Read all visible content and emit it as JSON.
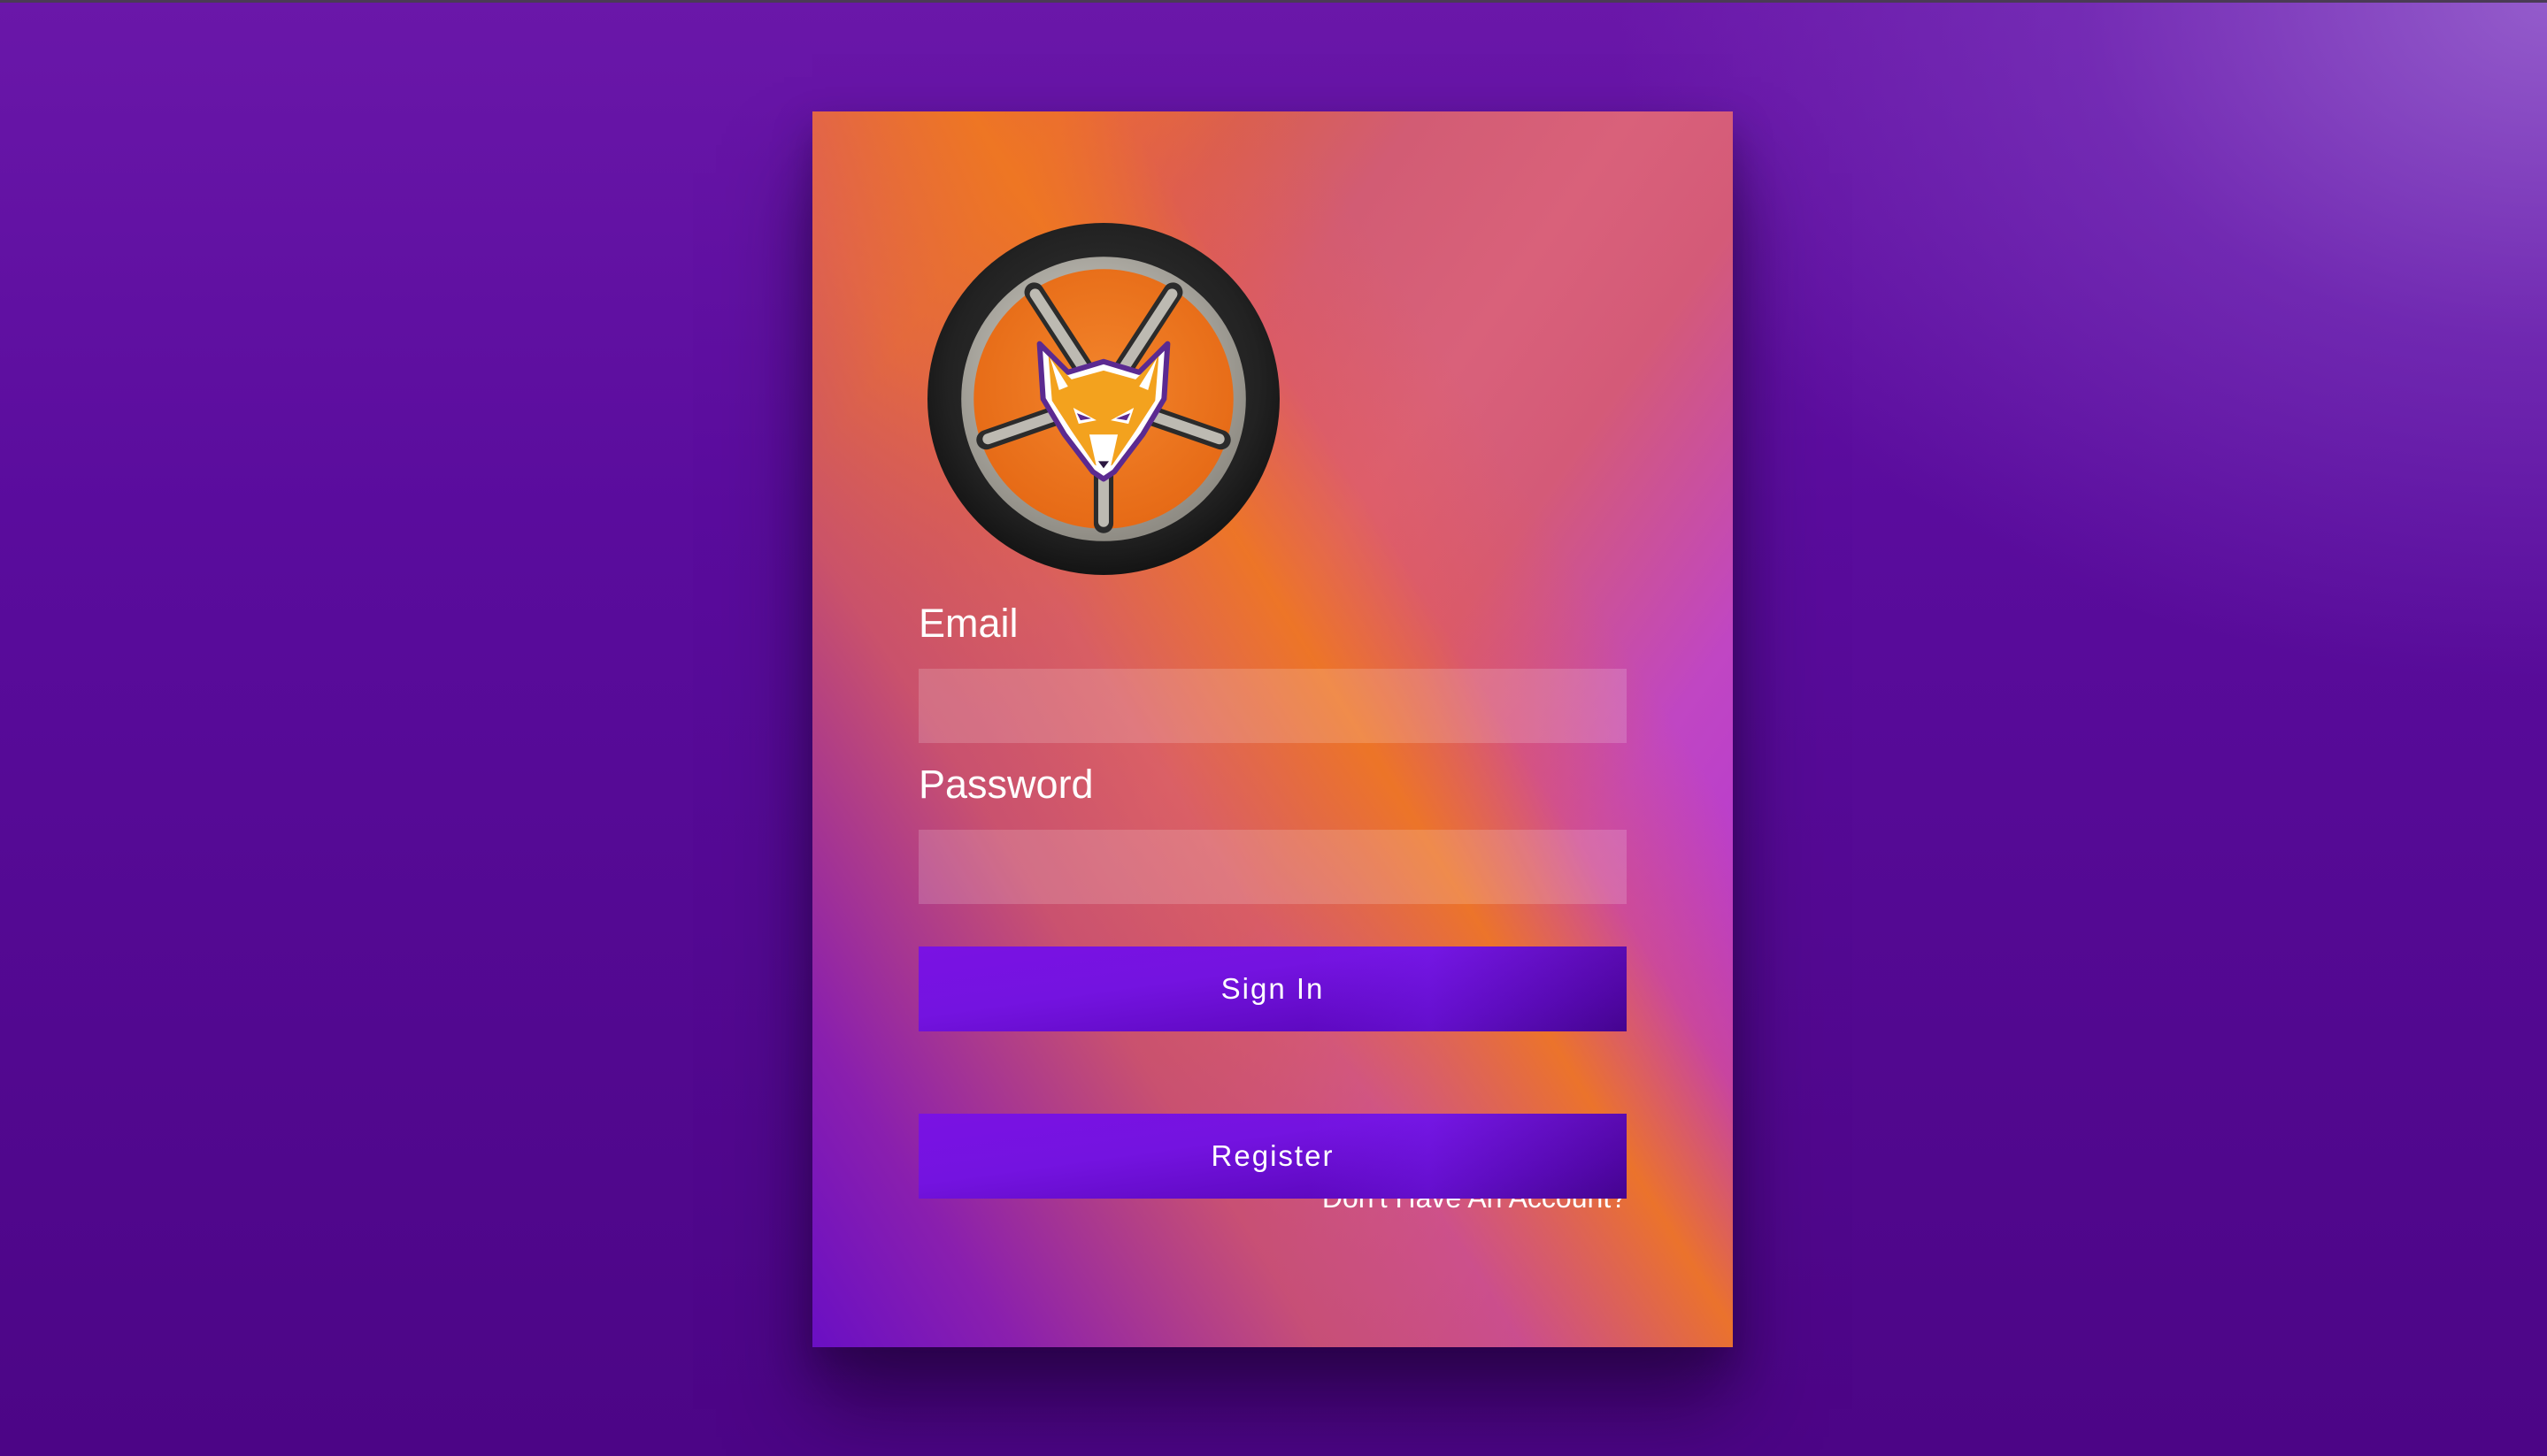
{
  "login_form": {
    "email_label": "Email",
    "email_value": "",
    "password_label": "Password",
    "password_value": "",
    "sign_in_label": "Sign In",
    "register_prompt": "Don't Have An Account?",
    "register_label": "Register"
  },
  "logo": {
    "icon": "fox-wheel-logo"
  },
  "colors": {
    "background": "#5a0c9d",
    "card_orange": "#ed7522",
    "card_pink": "#d45a78",
    "card_magenta": "#ac2ce0",
    "button_purple": "#7413e0",
    "text": "#ffffff"
  }
}
